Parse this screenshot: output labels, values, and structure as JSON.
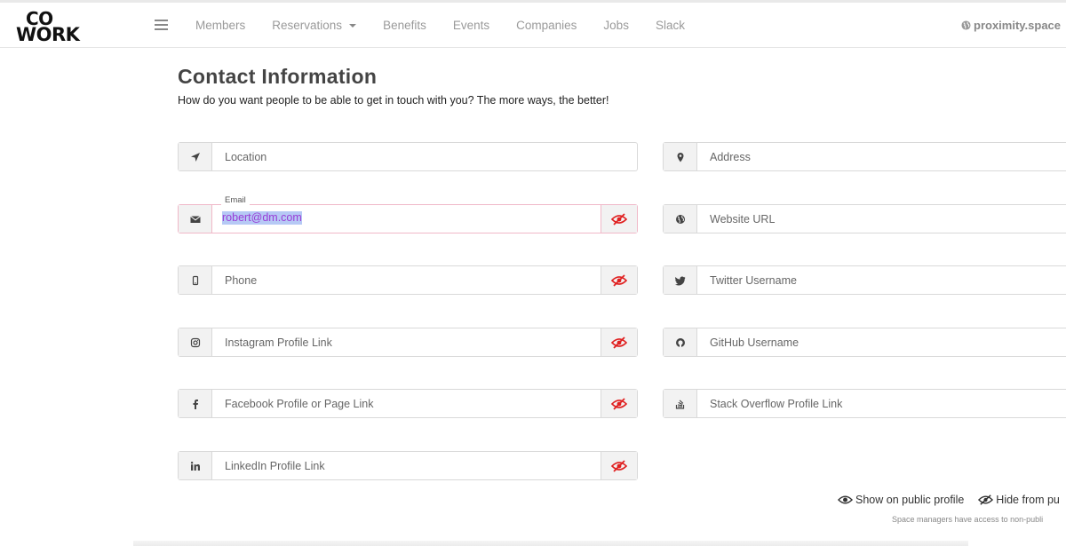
{
  "brand": {
    "line1": "CO",
    "line2": "WORK"
  },
  "nav": {
    "items": [
      "Members",
      "Reservations",
      "Benefits",
      "Events",
      "Companies",
      "Jobs",
      "Slack"
    ],
    "space": "proximity.space"
  },
  "page": {
    "title": "Contact Information",
    "subtitle": "How do you want people to be able to get in touch with you? The more ways, the better!"
  },
  "fields": {
    "location": {
      "placeholder": "Location",
      "icon": "location-arrow-icon"
    },
    "email": {
      "label": "Email",
      "value": "robert@dm.com",
      "icon": "envelope-icon"
    },
    "phone": {
      "placeholder": "Phone",
      "icon": "mobile-icon"
    },
    "instagram": {
      "placeholder": "Instagram Profile Link",
      "icon": "instagram-icon"
    },
    "facebook": {
      "placeholder": "Facebook Profile or Page Link",
      "icon": "facebook-icon"
    },
    "linkedin": {
      "placeholder": "LinkedIn Profile Link",
      "icon": "linkedin-icon"
    },
    "address": {
      "placeholder": "Address",
      "icon": "map-pin-icon"
    },
    "website": {
      "placeholder": "Website URL",
      "icon": "globe-icon"
    },
    "twitter": {
      "placeholder": "Twitter Username",
      "icon": "twitter-icon"
    },
    "github": {
      "placeholder": "GitHub Username",
      "icon": "github-icon"
    },
    "stackoverflow": {
      "placeholder": "Stack Overflow Profile Link",
      "icon": "stack-overflow-icon"
    }
  },
  "legend": {
    "show": "Show on public profile",
    "hide": "Hide from pu",
    "note": "Space managers have access to non-publi"
  },
  "colors": {
    "hidden_toggle": "#e02020",
    "accent_border": "#f0b8c8"
  }
}
